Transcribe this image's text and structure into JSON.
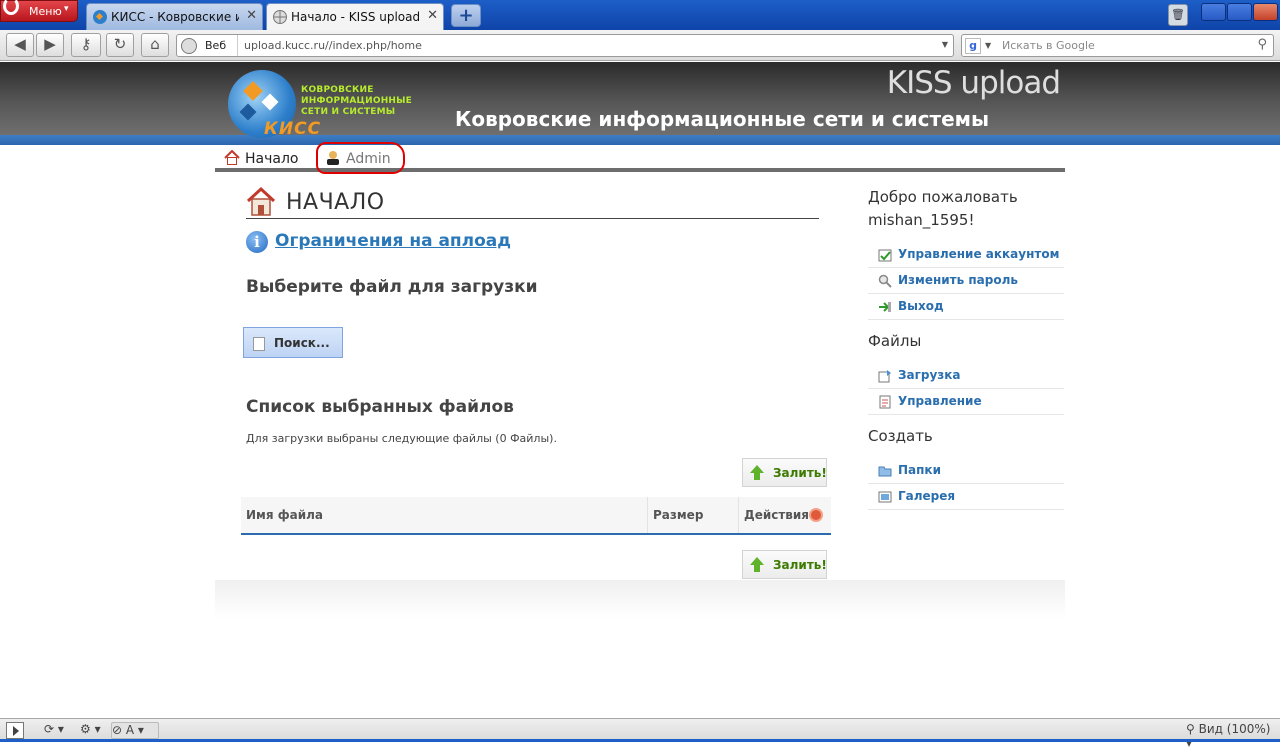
{
  "browser": {
    "menu_label": "Меню",
    "tabs": [
      {
        "title": "КИСС - Ковровские ин…",
        "active": false
      },
      {
        "title": "Начало - KISS upload",
        "active": true
      }
    ],
    "address": {
      "mode_label": "Веб",
      "url": "upload.kucc.ru//index.php/home"
    },
    "search": {
      "engine": "Google",
      "placeholder": "Искать в Google"
    },
    "zoom": "Вид (100%)"
  },
  "site": {
    "logo_lines": [
      "КОВРОВСКИЕ",
      "ИНФОРМАЦИОННЫЕ",
      "СЕТИ И СИСТЕМЫ"
    ],
    "logo_name": "КИСС",
    "title": "KISS upload",
    "subtitle": "Ковровские информационные сети и системы"
  },
  "menu": {
    "home": "Начало",
    "admin": "Admin"
  },
  "main": {
    "heading": "НАЧАЛО",
    "limits_link": "Ограничения на аплоад",
    "choose_file": "Выберите файл для загрузки",
    "browse_button": "Поиск...",
    "list_title": "Список выбранных файлов",
    "list_note": "Для загрузки выбраны следующие файлы (0 Файлы).",
    "upload_button": "Залить!",
    "table_headers": {
      "name": "Имя файла",
      "size": "Размер",
      "actions": "Действия"
    }
  },
  "sidebar": {
    "welcome_line1": "Добро пожаловать",
    "welcome_line2": "mishan_1595!",
    "account_links": [
      "Управление аккаунтом",
      "Изменить пароль",
      "Выход"
    ],
    "files_title": "Файлы",
    "files_links": [
      "Загрузка",
      "Управление"
    ],
    "create_title": "Создать",
    "create_links": [
      "Папки",
      "Галерея"
    ]
  },
  "colors": {
    "accent_blue": "#2a6eae",
    "header_dark": "#3a3a3a",
    "highlight_red": "#e00000",
    "upload_green": "#3d7a00"
  }
}
